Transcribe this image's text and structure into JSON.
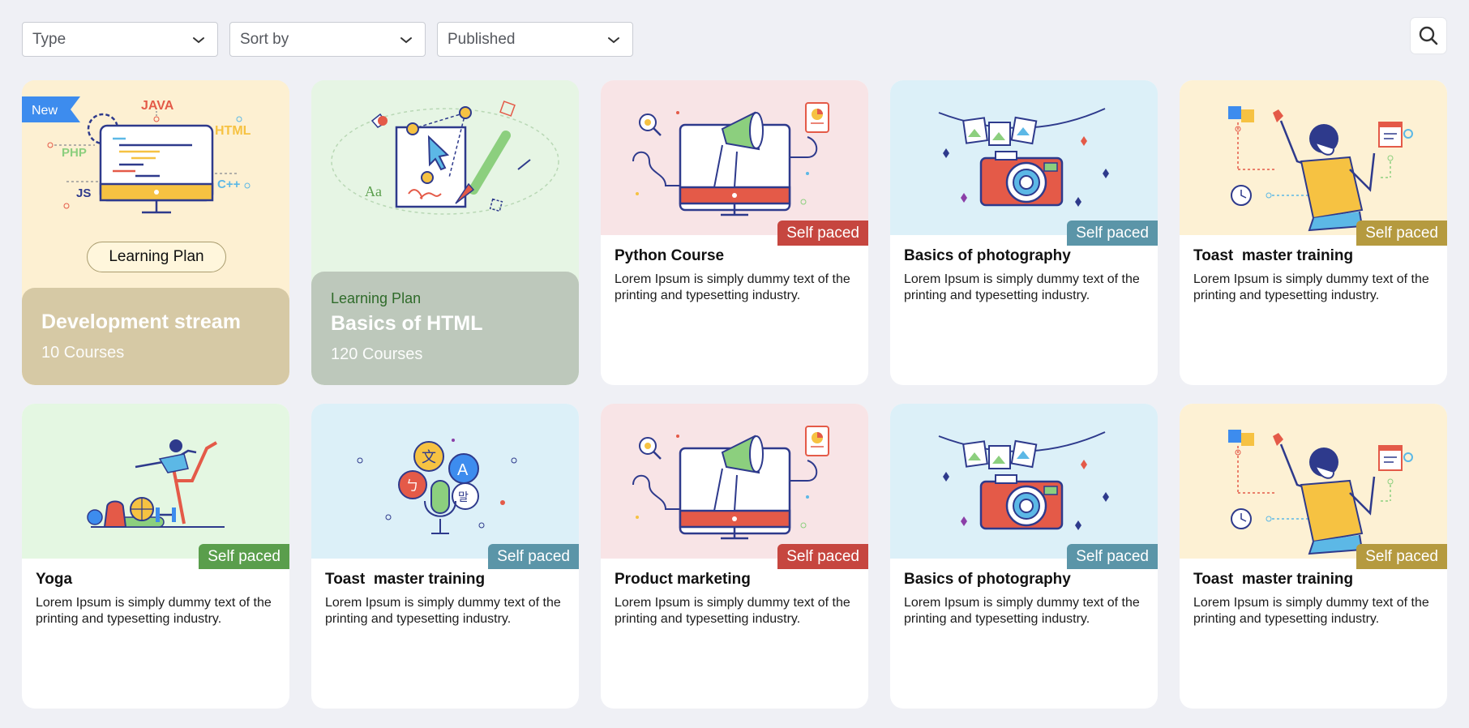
{
  "filters": {
    "type": "Type",
    "sort": "Sort by",
    "published": "Published"
  },
  "search_icon": "search-icon",
  "plans": [
    {
      "new_tag": "New",
      "pill": "Learning Plan",
      "title": "Development stream",
      "count": "10 Courses",
      "tech_labels": [
        "JAVA",
        "HTML",
        "PHP",
        "JS",
        "C++"
      ]
    },
    {
      "kicker": "Learning Plan",
      "title": "Basics of HTML",
      "count": "120 Courses",
      "art_text": "Aa"
    }
  ],
  "courses": [
    {
      "title": "Python Course",
      "badge": "Self paced",
      "badge_color": "#c6463f",
      "desc": "Lorem Ipsum is simply dummy text of the printing and typesetting industry.",
      "art": "marketing",
      "bg": "#f8e4e6"
    },
    {
      "title": "Basics of photography",
      "badge": "Self paced",
      "badge_color": "#5b95a8",
      "desc": "Lorem Ipsum is simply dummy text of the printing and typesetting industry.",
      "art": "camera",
      "bg": "#dcf0f8"
    },
    {
      "title": "Toast  master training",
      "badge": "Self paced",
      "badge_color": "#b59a3f",
      "desc": "Lorem Ipsum is simply dummy text of the printing and typesetting industry.",
      "art": "puzzle",
      "bg": "#fdf1d4"
    },
    {
      "title": "Yoga",
      "badge": "Self paced",
      "badge_color": "#5a9e4c",
      "desc": "Lorem Ipsum is simply dummy text of the printing and typesetting industry.",
      "art": "yoga",
      "bg": "#e4f7e2"
    },
    {
      "title": "Toast  master training",
      "badge": "Self paced",
      "badge_color": "#5b95a8",
      "desc": "Lorem Ipsum is simply dummy text of the printing and typesetting industry.",
      "art": "language",
      "bg": "#dcf0f8",
      "art_text": [
        "文",
        "A",
        "ㄅ",
        "말"
      ]
    },
    {
      "title": "Product marketing",
      "badge": "Self paced",
      "badge_color": "#c6463f",
      "desc": "Lorem Ipsum is simply dummy text of the printing and typesetting industry.",
      "art": "marketing",
      "bg": "#f8e4e6"
    },
    {
      "title": "Basics of photography",
      "badge": "Self paced",
      "badge_color": "#5b95a8",
      "desc": "Lorem Ipsum is simply dummy text of the printing and typesetting industry.",
      "art": "camera",
      "bg": "#dcf0f8"
    },
    {
      "title": "Toast  master training",
      "badge": "Self paced",
      "badge_color": "#b59a3f",
      "desc": "Lorem Ipsum is simply dummy text of the printing and typesetting industry.",
      "art": "puzzle",
      "bg": "#fdf1d4"
    }
  ]
}
